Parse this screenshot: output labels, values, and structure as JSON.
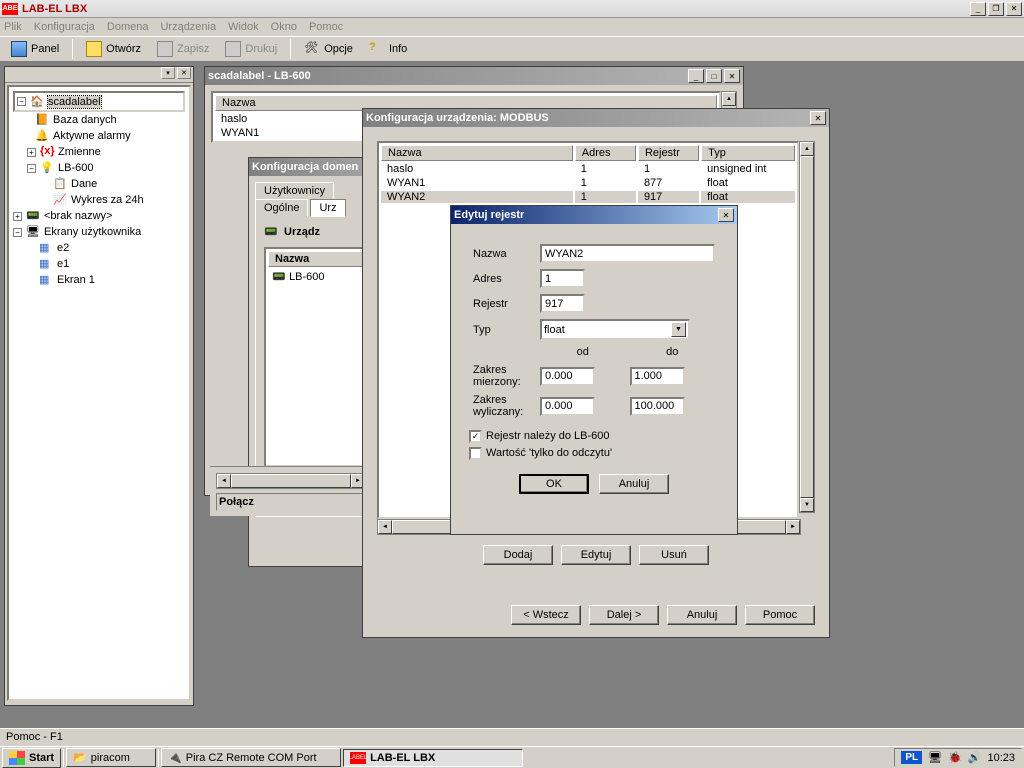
{
  "app": {
    "title": "LAB-EL LBX",
    "logo_text": "LABEL"
  },
  "menu": {
    "plik": "Plik",
    "konfiguracja": "Konfiguracja",
    "domena": "Domena",
    "urzadzenia": "Urządzenia",
    "widok": "Widok",
    "okno": "Okno",
    "pomoc": "Pomoc"
  },
  "toolbar": {
    "panel": "Panel",
    "otworz": "Otwórz",
    "zapisz": "Zapisz",
    "drukuj": "Drukuj",
    "opcje": "Opcje",
    "info": "Info"
  },
  "tree": {
    "root": "scadalabel",
    "baza": "Baza danych",
    "alarmy": "Aktywne alarmy",
    "zmienne": "Zmienne",
    "lb600": "LB-600",
    "dane": "Dane",
    "wykres": "Wykres za 24h",
    "brak": "<brak nazwy>",
    "ekrany": "Ekrany użytkownika",
    "e2": "e2",
    "e1": "e1",
    "ekran1": "Ekran 1"
  },
  "win1": {
    "title": "scadalabel - LB-600",
    "col_nazwa": "Nazwa",
    "row1": "haslo",
    "row2": "WYAN1",
    "tab_title": "Konfiguracja domen",
    "tab_uzytkownicy": "Użytkownicy",
    "tab_ogolne": "Ogólne",
    "tab_urz": "Urz",
    "urzadz": "Urządz",
    "inner_col": "Nazwa",
    "inner_row": "LB-600",
    "status": "Połącz"
  },
  "win2": {
    "title": "Konfiguracja urządzenia: MODBUS",
    "col_nazwa": "Nazwa",
    "col_adres": "Adres",
    "col_rejestr": "Rejestr",
    "col_typ": "Typ",
    "rows": [
      {
        "n": "haslo",
        "a": "1",
        "r": "1",
        "t": "unsigned int"
      },
      {
        "n": "WYAN1",
        "a": "1",
        "r": "877",
        "t": "float"
      },
      {
        "n": "WYAN2",
        "a": "1",
        "r": "917",
        "t": "float"
      }
    ],
    "dodaj": "Dodaj",
    "edytuj": "Edytuj",
    "usun": "Usuń",
    "wstecz": "< Wstecz",
    "dalej": "Dalej >",
    "anuluj": "Anuluj",
    "pomoc": "Pomoc"
  },
  "dlg": {
    "title": "Edytuj rejestr",
    "nazwa_l": "Nazwa",
    "nazwa_v": "WYAN2",
    "adres_l": "Adres",
    "adres_v": "1",
    "rejestr_l": "Rejestr",
    "rejestr_v": "917",
    "typ_l": "Typ",
    "typ_v": "float",
    "od": "od",
    "do": "do",
    "zm_l": "Zakres mierzony:",
    "zm_od": "0.000",
    "zm_do": "1.000",
    "zw_l": "Zakres wyliczany:",
    "zw_od": "0.000",
    "zw_do": "100.000",
    "chk1": "Rejestr należy do LB-600",
    "chk2": "Wartość 'tylko do odczytu'",
    "ok": "OK",
    "anuluj": "Anuluj"
  },
  "status": "Pomoc - F1",
  "taskbar": {
    "start": "Start",
    "t1": "piracom",
    "t2": "Pira CZ Remote COM Port",
    "t3": "LAB-EL LBX",
    "lang": "PL",
    "time": "10:23"
  }
}
